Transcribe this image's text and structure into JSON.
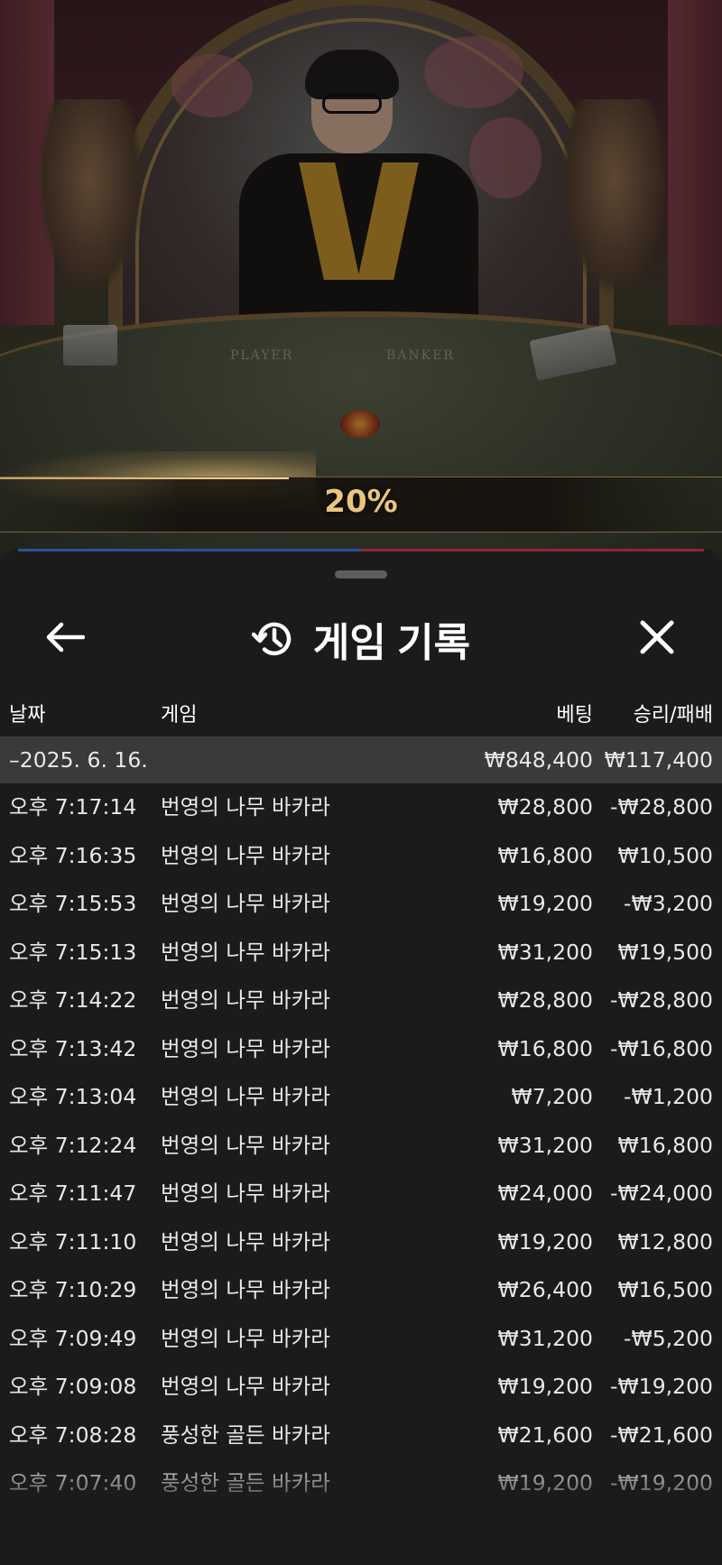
{
  "video": {
    "table_labels": {
      "player": "PLAYER",
      "banker": "BANKER"
    },
    "progress_text": "20%",
    "progress_fraction": 0.2
  },
  "sheet": {
    "back_icon": "arrow-left-icon",
    "history_icon": "history-clock-icon",
    "close_icon": "close-icon",
    "title": "게임 기록",
    "columns": {
      "date": "날짜",
      "game": "게임",
      "bet": "베팅",
      "winloss": "승리/패배"
    },
    "date_group": {
      "date": "–2025. 6. 16.",
      "total_bet": "₩848,400",
      "total_winloss": "₩117,400"
    },
    "rows": [
      {
        "time": "오후 7:17:14",
        "game": "번영의 나무 바카라",
        "bet": "₩28,800",
        "winloss": "-₩28,800"
      },
      {
        "time": "오후 7:16:35",
        "game": "번영의 나무 바카라",
        "bet": "₩16,800",
        "winloss": "₩10,500"
      },
      {
        "time": "오후 7:15:53",
        "game": "번영의 나무 바카라",
        "bet": "₩19,200",
        "winloss": "-₩3,200"
      },
      {
        "time": "오후 7:15:13",
        "game": "번영의 나무 바카라",
        "bet": "₩31,200",
        "winloss": "₩19,500"
      },
      {
        "time": "오후 7:14:22",
        "game": "번영의 나무 바카라",
        "bet": "₩28,800",
        "winloss": "-₩28,800"
      },
      {
        "time": "오후 7:13:42",
        "game": "번영의 나무 바카라",
        "bet": "₩16,800",
        "winloss": "-₩16,800"
      },
      {
        "time": "오후 7:13:04",
        "game": "번영의 나무 바카라",
        "bet": "₩7,200",
        "winloss": "-₩1,200"
      },
      {
        "time": "오후 7:12:24",
        "game": "번영의 나무 바카라",
        "bet": "₩31,200",
        "winloss": "₩16,800"
      },
      {
        "time": "오후 7:11:47",
        "game": "번영의 나무 바카라",
        "bet": "₩24,000",
        "winloss": "-₩24,000"
      },
      {
        "time": "오후 7:11:10",
        "game": "번영의 나무 바카라",
        "bet": "₩19,200",
        "winloss": "₩12,800"
      },
      {
        "time": "오후 7:10:29",
        "game": "번영의 나무 바카라",
        "bet": "₩26,400",
        "winloss": "₩16,500"
      },
      {
        "time": "오후 7:09:49",
        "game": "번영의 나무 바카라",
        "bet": "₩31,200",
        "winloss": "-₩5,200"
      },
      {
        "time": "오후 7:09:08",
        "game": "번영의 나무 바카라",
        "bet": "₩19,200",
        "winloss": "-₩19,200"
      },
      {
        "time": "오후 7:08:28",
        "game": "풍성한 골든 바카라",
        "bet": "₩21,600",
        "winloss": "-₩21,600"
      },
      {
        "time": "오후 7:07:40",
        "game": "풍성한 골든 바카라",
        "bet": "₩19,200",
        "winloss": "-₩19,200"
      }
    ]
  },
  "colors": {
    "sheet_bg": "#1b1b1b",
    "date_row_bg": "#3a3a3a",
    "progress_gold": "#e9c67d"
  }
}
